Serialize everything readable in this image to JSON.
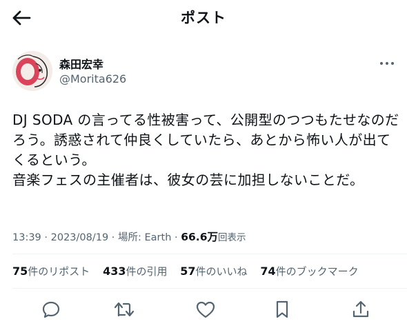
{
  "header": {
    "title": "ポスト",
    "back_icon": "arrow-left-icon"
  },
  "post": {
    "author": {
      "display_name": "森田宏幸",
      "handle": "@Morita626"
    },
    "text_lines": [
      "DJ SODA の言ってる性被害って、公開型のつつもたせなのだ",
      "ろう。誘惑されて仲良くしていたら、あとから怖い人が出て",
      "くるという。",
      "音楽フェスの主催者は、彼女の芸に加担しないことだ。"
    ],
    "meta": {
      "time": "13:39 · 2023/08/19",
      "location": "場所: Earth",
      "views_count": "66.6万",
      "views_label": "回表示",
      "separator": "·"
    },
    "stats": [
      {
        "count": "75",
        "label": "件のリポスト"
      },
      {
        "count": "433",
        "label": "件の引用"
      },
      {
        "count": "57",
        "label": "件のいいね"
      },
      {
        "count": "74",
        "label": "件のブックマーク"
      }
    ]
  },
  "actions": {
    "reply_icon": "reply-icon",
    "repost_icon": "repost-icon",
    "like_icon": "heart-icon",
    "bookmark_icon": "bookmark-icon",
    "share_icon": "share-icon"
  },
  "colors": {
    "text": "#0f1419",
    "secondary": "#536471",
    "divider": "#eff3f4",
    "avatar_accent": "#d9445b"
  }
}
